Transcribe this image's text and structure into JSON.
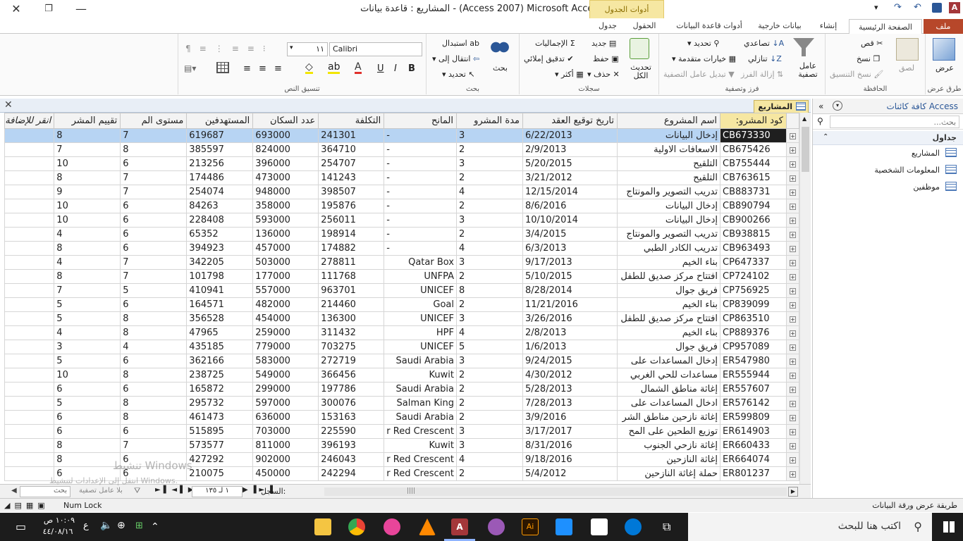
{
  "window": {
    "title": "المشاريع : قاعدة بيانات - (Access 2007) Microsoft Access",
    "context_tab": "أدوات الجدول"
  },
  "tabs": [
    "ملف",
    "الصفحة الرئيسية",
    "إنشاء",
    "بيانات خارجية",
    "أدوات قاعدة البيانات",
    "الحقول",
    "جدول"
  ],
  "ribbon": {
    "views": {
      "label": "عرض",
      "group": "طرق عرض"
    },
    "clipboard": {
      "paste": "لصق",
      "cut": "قص",
      "copy": "نسخ",
      "format_painter": "نسخ التنسيق",
      "group": "الحافظة"
    },
    "sort": {
      "filter": "عامل تصفية",
      "asc": "تصاعدي",
      "desc": "تنازلي",
      "remove_sort": "إزالة الفرز",
      "selection": "تحديد",
      "advanced": "خيارات متقدمة",
      "toggle": "تبديل عامل التصفية",
      "group": "فرز وتصفية"
    },
    "records": {
      "refresh": "تحديث الكل",
      "new": "جديد",
      "save": "حفظ",
      "delete": "حذف",
      "totals": "الإجماليات",
      "spelling": "تدقيق إملائي",
      "more": "أكثر",
      "group": "سجلات"
    },
    "find": {
      "find": "بحث",
      "replace": "استبدال",
      "goto": "انتقال إلى",
      "select": "تحديد",
      "group": "بحث"
    },
    "text": {
      "font": "Calibri",
      "size": "١١",
      "group": "تنسيق النص"
    }
  },
  "doc_tab": "المشاريع",
  "table": {
    "headers": [
      "كود المشرو:",
      "اسم المشروع",
      "تاريخ توقيع العقد",
      "مدة المشرو",
      "المانح",
      "التكلفة",
      "عدد السكان",
      "المستهدفين",
      "مستوى الم",
      "تقييم المشر",
      "انقر للإضافة"
    ],
    "rows": [
      [
        "CB673330",
        "إدخال البيانات",
        "6/22/2013",
        "3",
        "-",
        "241301",
        "693000",
        "619687",
        "7",
        "8"
      ],
      [
        "CB675426",
        "الاسعافات الاولية",
        "2/9/2013",
        "2",
        "-",
        "364710",
        "824000",
        "385597",
        "8",
        "7"
      ],
      [
        "CB755444",
        "التلقيح",
        "5/20/2015",
        "3",
        "-",
        "254707",
        "396000",
        "213256",
        "6",
        "10"
      ],
      [
        "CB763615",
        "التلقيح",
        "3/21/2012",
        "2",
        "-",
        "141243",
        "473000",
        "174486",
        "7",
        "8"
      ],
      [
        "CB883731",
        "تدريب التصوير والمونتاج",
        "12/15/2014",
        "4",
        "-",
        "398507",
        "948000",
        "254074",
        "7",
        "9"
      ],
      [
        "CB890794",
        "إدخال البيانات",
        "8/6/2016",
        "2",
        "-",
        "195876",
        "358000",
        "84263",
        "6",
        "10"
      ],
      [
        "CB900266",
        "إدخال البيانات",
        "10/10/2014",
        "3",
        "-",
        "256011",
        "593000",
        "228408",
        "6",
        "10"
      ],
      [
        "CB938815",
        "تدريب التصوير والمونتاج",
        "3/4/2015",
        "2",
        "-",
        "198914",
        "136000",
        "65352",
        "6",
        "4"
      ],
      [
        "CB963493",
        "تدريب الكادر الطبي",
        "6/3/2013",
        "4",
        "-",
        "174882",
        "457000",
        "394923",
        "6",
        "8"
      ],
      [
        "CP647337",
        "بناء الخيم",
        "9/17/2013",
        "3",
        "Qatar Box",
        "278811",
        "503000",
        "342205",
        "7",
        "4"
      ],
      [
        "CP724102",
        "افتتاح مركز صديق للطفل",
        "5/10/2015",
        "2",
        "UNFPA",
        "111768",
        "177000",
        "101798",
        "7",
        "8"
      ],
      [
        "CP756925",
        "فريق جوال",
        "8/28/2014",
        "8",
        "UNICEF",
        "963701",
        "557000",
        "410941",
        "5",
        "7"
      ],
      [
        "CP839099",
        "بناء الخيم",
        "11/21/2016",
        "2",
        "Goal",
        "214460",
        "482000",
        "164571",
        "6",
        "5"
      ],
      [
        "CP863510",
        "افتتاح مركز صديق للطفل",
        "3/26/2016",
        "3",
        "UNICEF",
        "136300",
        "454000",
        "356528",
        "8",
        "5"
      ],
      [
        "CP889376",
        "بناء الخيم",
        "2/8/2013",
        "4",
        "HPF",
        "311432",
        "259000",
        "47965",
        "8",
        "4"
      ],
      [
        "CP957089",
        "فريق جوال",
        "1/6/2013",
        "5",
        "UNICEF",
        "703275",
        "779000",
        "435185",
        "4",
        "3"
      ],
      [
        "ER547980",
        "إدخال المساعدات على",
        "9/24/2015",
        "3",
        "Saudi Arabia",
        "272719",
        "583000",
        "362166",
        "6",
        "5"
      ],
      [
        "ER555944",
        "مساعدات للحي الغربي",
        "4/30/2012",
        "2",
        "Kuwit",
        "366456",
        "549000",
        "238725",
        "8",
        "10"
      ],
      [
        "ER557607",
        "إغاثة مناطق الشمال",
        "5/28/2013",
        "2",
        "Saudi Arabia",
        "197786",
        "299000",
        "165872",
        "6",
        "6"
      ],
      [
        "ER576142",
        "ادخال المساعدات على",
        "7/28/2013",
        "2",
        "Salman King",
        "300076",
        "597000",
        "295732",
        "8",
        "5"
      ],
      [
        "ER599809",
        "إغاثة نازحين مناطق الشر",
        "3/9/2016",
        "2",
        "Saudi Arabia",
        "153163",
        "636000",
        "461473",
        "8",
        "6"
      ],
      [
        "ER614903",
        "توزيع الطحين على المح",
        "3/17/2017",
        "3",
        "r Red Crescent",
        "225590",
        "703000",
        "515895",
        "6",
        "6"
      ],
      [
        "ER660433",
        "إغاثة نازحي الجنوب",
        "8/31/2016",
        "3",
        "Kuwit",
        "396193",
        "811000",
        "573577",
        "7",
        "8"
      ],
      [
        "ER664074",
        "إغاثة النازحين",
        "9/18/2016",
        "4",
        "r Red Crescent",
        "246043",
        "902000",
        "427292",
        "6",
        "8"
      ],
      [
        "ER801237",
        "حملة إغاثة النازحين",
        "5/4/2012",
        "2",
        "r Red Crescent",
        "242294",
        "450000",
        "210075",
        "6",
        "6"
      ]
    ]
  },
  "record_nav": {
    "label": "السجل:",
    "value": "١ لـ ١٣٥",
    "filter": "بلا عامل تصفية",
    "search": "بحث"
  },
  "nav_pane": {
    "title": "كافة كائنات Access",
    "search_placeholder": "بحث...",
    "section": "جداول",
    "items": [
      "المشاريع",
      "المعلومات الشخصية",
      "موظفين"
    ]
  },
  "status": {
    "left": "طريقة عرض ورقة البيانات",
    "numlock": "Num Lock"
  },
  "watermark": {
    "line1": "تنشيط Windows",
    "line2": "انتقل إلى الإعدادات لتنشيط Windows."
  },
  "taskbar": {
    "search": "اكتب هنا للبحث",
    "time": "١٠:٠٩ ص",
    "date": "٤٤/٠٨/١٦",
    "lang": "ع"
  }
}
